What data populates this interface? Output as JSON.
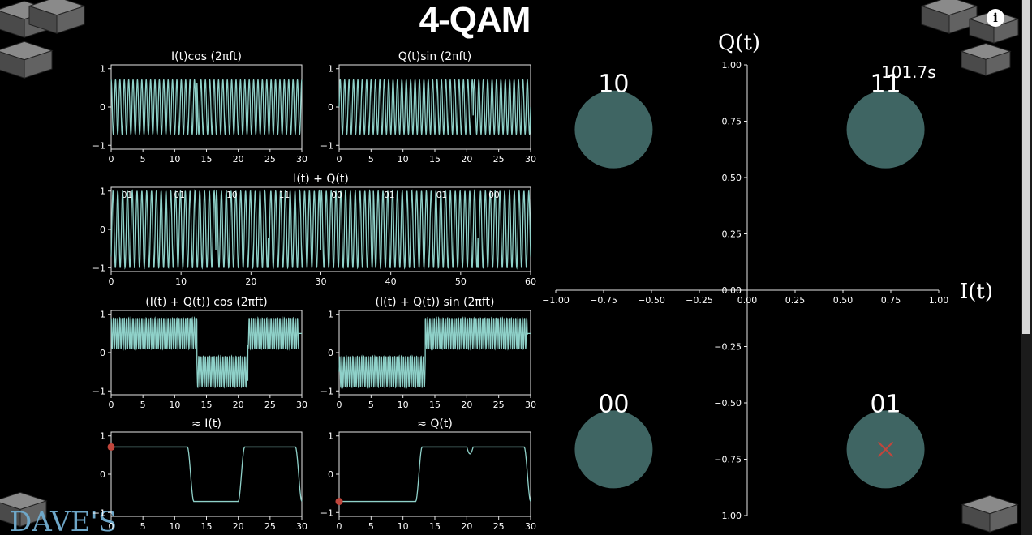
{
  "page": {
    "title": "4-QAM",
    "timer": "101.7s",
    "brand": "DAVE'S"
  },
  "colors": {
    "signal": "#8fd1c9",
    "axes": "#e6e6e6",
    "circle": "#3f6563",
    "marker": "#c0463c",
    "bg": "#000000"
  },
  "icons": {
    "info": "info-icon",
    "cubes": "cube-decoration"
  },
  "chart_data": [
    {
      "id": "icos",
      "type": "line",
      "title": "I(t)cos (2πft)",
      "xticks": [
        0,
        5,
        10,
        15,
        20,
        25,
        30
      ],
      "yticks": [
        -1,
        0,
        1
      ],
      "xlim": [
        0,
        30
      ],
      "ylim": [
        -1.1,
        1.1
      ]
    },
    {
      "id": "qsin",
      "type": "line",
      "title": "Q(t)sin (2πft)",
      "xticks": [
        0,
        5,
        10,
        15,
        20,
        25,
        30
      ],
      "yticks": [
        -1,
        0,
        1
      ],
      "xlim": [
        0,
        30
      ],
      "ylim": [
        -1.1,
        1.1
      ]
    },
    {
      "id": "sum",
      "type": "line",
      "title": "I(t) + Q(t)",
      "xticks": [
        0,
        10,
        20,
        30,
        40,
        50,
        60
      ],
      "yticks": [
        -1,
        0,
        1
      ],
      "xlim": [
        0,
        60
      ],
      "ylim": [
        -1.1,
        1.1
      ],
      "symbols": [
        "01",
        "01",
        "10",
        "11",
        "00",
        "01",
        "01",
        "00"
      ]
    },
    {
      "id": "mixcos",
      "type": "line",
      "title": "(I(t) + Q(t)) cos (2πft)",
      "xticks": [
        0,
        5,
        10,
        15,
        20,
        25,
        30
      ],
      "yticks": [
        -1,
        0,
        1
      ],
      "xlim": [
        0,
        30
      ],
      "ylim": [
        -1.1,
        1.1
      ]
    },
    {
      "id": "mixsin",
      "type": "line",
      "title": "(I(t) + Q(t)) sin (2πft)",
      "xticks": [
        0,
        5,
        10,
        15,
        20,
        25,
        30
      ],
      "yticks": [
        -1,
        0,
        1
      ],
      "xlim": [
        0,
        30
      ],
      "ylim": [
        -1.1,
        1.1
      ]
    },
    {
      "id": "irec",
      "type": "line",
      "title": "≈ I(t)",
      "xticks": [
        0,
        5,
        10,
        15,
        20,
        25,
        30
      ],
      "yticks": [
        -1,
        0,
        1
      ],
      "xlim": [
        0,
        30
      ],
      "ylim": [
        -1.1,
        1.1
      ],
      "levels": [
        [
          0,
          12,
          0.71
        ],
        [
          13,
          20,
          -0.71
        ],
        [
          21,
          29,
          0.71
        ],
        [
          30,
          30,
          -0.71
        ]
      ],
      "marker": [
        0,
        0.71
      ]
    },
    {
      "id": "qrec",
      "type": "line",
      "title": "≈ Q(t)",
      "xticks": [
        0,
        5,
        10,
        15,
        20,
        25,
        30
      ],
      "yticks": [
        -1,
        0,
        1
      ],
      "xlim": [
        0,
        30
      ],
      "ylim": [
        -1.1,
        1.1
      ],
      "levels": [
        [
          0,
          12,
          -0.71
        ],
        [
          13,
          29,
          0.71
        ],
        [
          30,
          30,
          -0.71
        ]
      ],
      "marker": [
        0,
        -0.71
      ]
    },
    {
      "id": "constellation",
      "type": "scatter",
      "xlabel": "I(t)",
      "ylabel": "Q(t)",
      "xlim": [
        -1,
        1
      ],
      "ylim": [
        -1,
        1
      ],
      "xticks": [
        "−1.00",
        "−0.75",
        "−0.50",
        "−0.25",
        "0.00",
        "0.25",
        "0.50",
        "0.75",
        "1.00"
      ],
      "yticks": [
        "1.00",
        "0.75",
        "0.50",
        "0.25",
        "0.00",
        "−0.25",
        "−0.50",
        "−0.75",
        "−1.00"
      ],
      "points": [
        {
          "label": "10",
          "x": -0.71,
          "y": 0.71
        },
        {
          "label": "11",
          "x": 0.71,
          "y": 0.71
        },
        {
          "label": "00",
          "x": -0.71,
          "y": -0.71
        },
        {
          "label": "01",
          "x": 0.71,
          "y": -0.71
        }
      ],
      "current": {
        "x": 0.71,
        "y": -0.71
      }
    }
  ]
}
